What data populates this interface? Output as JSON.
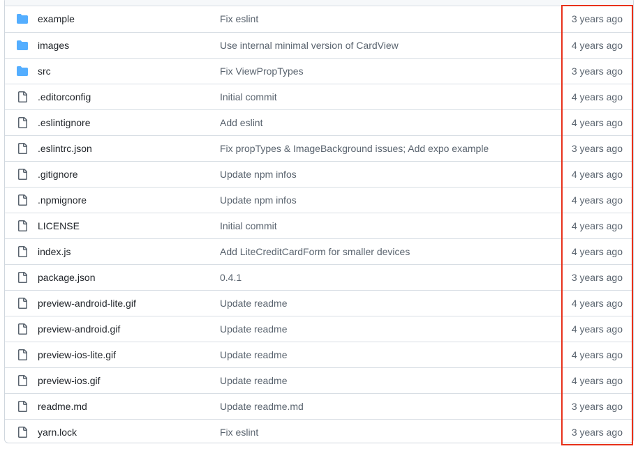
{
  "files": [
    {
      "name": "example",
      "type": "folder",
      "icon": "folder-icon",
      "message": "Fix eslint",
      "age": "3 years ago"
    },
    {
      "name": "images",
      "type": "folder",
      "icon": "folder-icon",
      "message": "Use internal minimal version of CardView",
      "age": "4 years ago"
    },
    {
      "name": "src",
      "type": "folder",
      "icon": "folder-icon",
      "message": "Fix ViewPropTypes",
      "age": "3 years ago"
    },
    {
      "name": ".editorconfig",
      "type": "file",
      "icon": "file-icon",
      "message": "Initial commit",
      "age": "4 years ago"
    },
    {
      "name": ".eslintignore",
      "type": "file",
      "icon": "file-icon",
      "message": "Add eslint",
      "age": "4 years ago"
    },
    {
      "name": ".eslintrc.json",
      "type": "file",
      "icon": "file-icon",
      "message": "Fix propTypes & ImageBackground issues; Add expo example",
      "age": "3 years ago"
    },
    {
      "name": ".gitignore",
      "type": "file",
      "icon": "file-icon",
      "message": "Update npm infos",
      "age": "4 years ago"
    },
    {
      "name": ".npmignore",
      "type": "file",
      "icon": "file-icon",
      "message": "Update npm infos",
      "age": "4 years ago"
    },
    {
      "name": "LICENSE",
      "type": "file",
      "icon": "file-icon",
      "message": "Initial commit",
      "age": "4 years ago"
    },
    {
      "name": "index.js",
      "type": "file",
      "icon": "file-icon",
      "message": "Add LiteCreditCardForm for smaller devices",
      "age": "4 years ago"
    },
    {
      "name": "package.json",
      "type": "file",
      "icon": "file-icon",
      "message": "0.4.1",
      "age": "3 years ago"
    },
    {
      "name": "preview-android-lite.gif",
      "type": "file",
      "icon": "file-icon",
      "message": "Update readme",
      "age": "4 years ago"
    },
    {
      "name": "preview-android.gif",
      "type": "file",
      "icon": "file-icon",
      "message": "Update readme",
      "age": "4 years ago"
    },
    {
      "name": "preview-ios-lite.gif",
      "type": "file",
      "icon": "file-icon",
      "message": "Update readme",
      "age": "4 years ago"
    },
    {
      "name": "preview-ios.gif",
      "type": "file",
      "icon": "file-icon",
      "message": "Update readme",
      "age": "4 years ago"
    },
    {
      "name": "readme.md",
      "type": "file",
      "icon": "file-icon",
      "message": "Update readme.md",
      "age": "3 years ago"
    },
    {
      "name": "yarn.lock",
      "type": "file",
      "icon": "file-icon",
      "message": "Fix eslint",
      "age": "3 years ago"
    }
  ],
  "colors": {
    "folder": "#54aeff",
    "file": "#59636e",
    "highlight": "#e8311a",
    "border": "#d8dee4"
  }
}
